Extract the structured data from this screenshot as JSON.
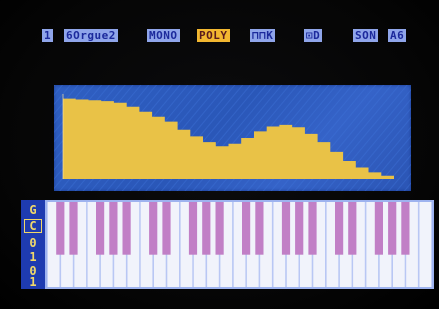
{
  "menu": {
    "items": [
      {
        "id": "channel",
        "label": "1"
      },
      {
        "id": "preset",
        "label": "6Orgue2"
      },
      {
        "id": "mono",
        "label": "MONO"
      },
      {
        "id": "poly",
        "label": "POLY",
        "selected": true
      },
      {
        "id": "wave",
        "label": "⊓⊓K"
      },
      {
        "id": "octave",
        "label": "⊡D"
      },
      {
        "id": "sound",
        "label": "SON"
      },
      {
        "id": "tempo",
        "label": "A6"
      }
    ]
  },
  "side_strip": {
    "glyphs": [
      "G",
      "C",
      "0",
      "1",
      "0",
      "1"
    ]
  },
  "waveform": {
    "description_values": [
      0.98,
      0.97,
      0.96,
      0.95,
      0.93,
      0.88,
      0.82,
      0.76,
      0.7,
      0.6,
      0.52,
      0.45,
      0.4,
      0.43,
      0.5,
      0.58,
      0.64,
      0.66,
      0.63,
      0.55,
      0.45,
      0.33,
      0.22,
      0.14,
      0.08,
      0.04
    ]
  },
  "colors": {
    "menu_bg": "#8fa5ea",
    "menu_text": "#1c2a9c",
    "selected_bg": "#f2b730",
    "wave_panel": "#2f5fc2",
    "wave_fill": "#e9c247",
    "white_key": "#f1f3fb",
    "black_key": "#c17fc6",
    "keyboard_bg": "#9eb3ef",
    "side_strip": "#1e3bb0"
  },
  "keyboard": {
    "white_key_count": 29,
    "black_pattern": [
      1,
      1,
      0,
      1,
      1,
      1,
      0
    ]
  }
}
